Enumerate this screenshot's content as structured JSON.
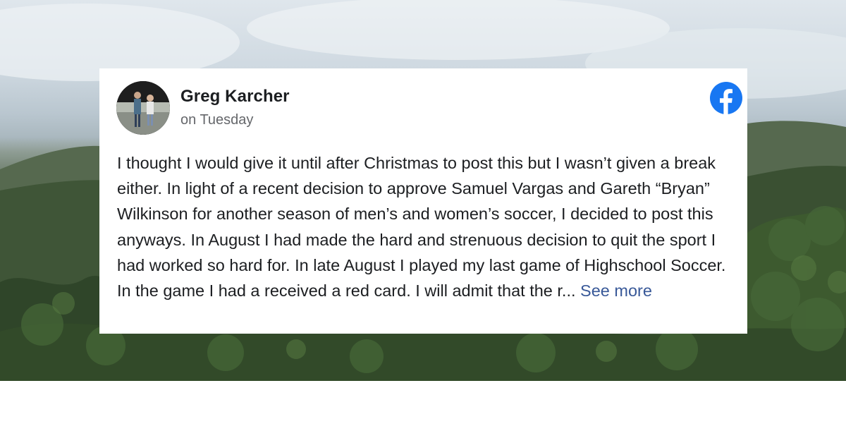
{
  "post": {
    "author": "Greg Karcher",
    "timestamp": "on Tuesday",
    "text": "I thought I would give it until after Christmas to post this but I wasn’t given a break either. In light of a recent decision to approve Samuel Vargas and Gareth “Bryan” Wilkinson for another season of men’s and women’s soccer, I decided to post this anyways. In August I had made the hard and strenuous decision to quit the sport I had worked so hard for. In late August I played my last game of Highschool Soccer. In the game I had a received a red card. I will admit that the r...",
    "see_more_label": "See more"
  },
  "icons": {
    "platform": "facebook-icon",
    "avatar": "avatar-photo"
  },
  "colors": {
    "facebook_blue": "#1877f2",
    "link_blue": "#385898",
    "text": "#1c1e21",
    "secondary_text": "#65676b"
  }
}
